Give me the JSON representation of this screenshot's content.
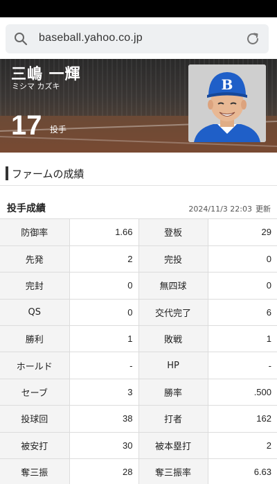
{
  "browser": {
    "url": "baseball.yahoo.co.jp"
  },
  "player": {
    "name": "三嶋 一輝",
    "kana": "ミシマ カズキ",
    "number": "17",
    "position": "投手"
  },
  "section": {
    "title": "ファームの成績"
  },
  "pitching": {
    "title": "投手成績",
    "date": "2024/11/3 22:03",
    "update_label": "更新",
    "rows": [
      {
        "label1": "防御率",
        "value1": "1.66",
        "label2": "登板",
        "value2": "29"
      },
      {
        "label1": "先発",
        "value1": "2",
        "label2": "完投",
        "value2": "0"
      },
      {
        "label1": "完封",
        "value1": "0",
        "label2": "無四球",
        "value2": "0"
      },
      {
        "label1": "QS",
        "value1": "0",
        "label2": "交代完了",
        "value2": "6"
      },
      {
        "label1": "勝利",
        "value1": "1",
        "label2": "敗戦",
        "value2": "1"
      },
      {
        "label1": "ホールド",
        "value1": "-",
        "label2": "HP",
        "value2": "-"
      },
      {
        "label1": "セーブ",
        "value1": "3",
        "label2": "勝率",
        "value2": ".500"
      },
      {
        "label1": "投球回",
        "value1": "38",
        "label2": "打者",
        "value2": "162"
      },
      {
        "label1": "被安打",
        "value1": "30",
        "label2": "被本塁打",
        "value2": "2"
      },
      {
        "label1": "奪三振",
        "value1": "28",
        "label2": "奪三振率",
        "value2": "6.63"
      }
    ]
  },
  "colors": {
    "cap_blue": "#1f5fc8",
    "status_bar": "#000000"
  }
}
